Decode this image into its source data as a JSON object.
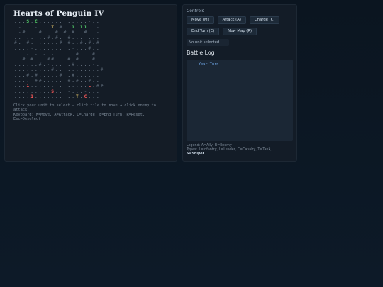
{
  "game": {
    "title": "Hearts of Penguin IV",
    "map": [
      "...S.C............-..",
      ".-...-...T.#..1.11..-.",
      ".-#...#...#.#.#..#..-",
      "..-..-..#.#..#...-...",
      "#.-#.-.....#.#..#.#.#",
      "....-.........-...#..",
      "...-.-.-.-.....#...#.",
      "..#.#...##...#.#...#.",
      "......#.-.....#....-.",
      ".........#...........#",
      "...#.#.....#..#......",
      "....-##......#.#..#..",
      "...1......-.-.....L.##",
      ".........S...-...-...",
      "....1..........T.C..."
    ],
    "help_line1": "Click your unit to select → click tile to move → click enemy to attack.",
    "help_line2": "Keyboard: M=Move, A=Attack, C=Charge, E=End Turn, R=Reset, Esc=Deselect"
  },
  "controls": {
    "title": "Controls",
    "move": "Move (M)",
    "attack": "Attack (A)",
    "charge": "Charge (C)",
    "end_turn": "End Turn (E)",
    "new_map": "New Map (R)",
    "status": "No unit selected"
  },
  "battle_log": {
    "title": "Battle Log",
    "lines": [
      "--- Your Turn ---"
    ]
  },
  "legend": {
    "line1": "Legend: A=Ally, B=Enemy",
    "line2": "Types: 1=Infantry, L=Leader, C=Cavalry, T=Tank,",
    "line3": "S=Sniper"
  },
  "colors": {
    "ally": "#55d36b",
    "enemy": "#ff5a5a",
    "tree": "#e3c56a",
    "log_text": "#6fa6e6"
  }
}
